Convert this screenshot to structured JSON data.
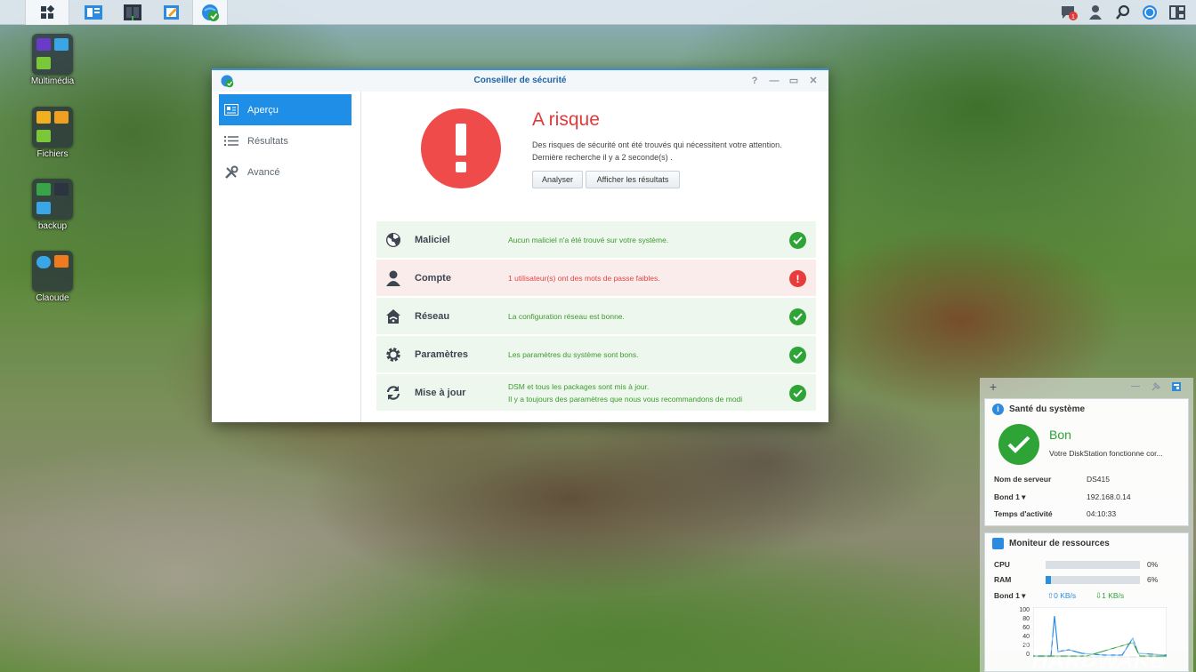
{
  "taskbar": {
    "apps": [
      "main-menu",
      "file-station",
      "storage-manager",
      "text-editor",
      "security-advisor"
    ],
    "tray": [
      "notifications",
      "user",
      "search",
      "dsm-help",
      "widgets"
    ],
    "notification_count": "1"
  },
  "desktop": {
    "icons": [
      {
        "label": "Multimédia"
      },
      {
        "label": "Fichiers"
      },
      {
        "label": "backup"
      },
      {
        "label": "Claoude"
      }
    ]
  },
  "window": {
    "title": "Conseiller de sécurité",
    "controls": {
      "help": "?",
      "minimize": "—",
      "maximize": "▭",
      "close": "✕"
    },
    "sidebar": [
      {
        "label": "Aperçu"
      },
      {
        "label": "Résultats"
      },
      {
        "label": "Avancé"
      }
    ],
    "status": {
      "title": "A risque",
      "line1": "Des risques de sécurité ont été trouvés qui nécessitent votre attention.",
      "line2": "Dernière recherche il y a 2 seconde(s) ."
    },
    "buttons": {
      "scan": "Analyser",
      "show_results": "Afficher les résultats"
    },
    "checks": [
      {
        "name": "Maliciel",
        "message": "Aucun maliciel n'a été trouvé sur votre système.",
        "status": "ok"
      },
      {
        "name": "Compte",
        "message": "1 utilisateur(s) ont des mots de passe faibles.",
        "status": "warning"
      },
      {
        "name": "Réseau",
        "message": "La configuration réseau est bonne.",
        "status": "ok"
      },
      {
        "name": "Paramètres",
        "message": "Les paramètres du système sont bons.",
        "status": "ok"
      },
      {
        "name": "Mise à jour",
        "message": "DSM et tous les packages sont mis à jour.",
        "message2": "Il y a toujours des paramètres que nous vous recommandons de modi",
        "status": "ok"
      }
    ]
  },
  "widgets": {
    "add": "+",
    "health": {
      "title": "Santé du système",
      "state": "Bon",
      "description": "Votre DiskStation fonctionne cor...",
      "rows": [
        {
          "key": "Nom de serveur",
          "value": "DS415"
        },
        {
          "key": "Bond 1 ▾",
          "value": "192.168.0.14"
        },
        {
          "key": "Temps d'activité",
          "value": "04:10:33"
        }
      ]
    },
    "monitor": {
      "title": "Moniteur de ressources",
      "cpu_label": "CPU",
      "cpu_pct": "0%",
      "cpu_value": 0,
      "ram_label": "RAM",
      "ram_pct": "6%",
      "ram_value": 6,
      "net_label": "Bond 1 ▾",
      "upload": "0 KB/s",
      "download": "1 KB/s",
      "y_ticks": [
        "100",
        "80",
        "60",
        "40",
        "20",
        "0"
      ]
    }
  },
  "watermark": {
    "line1": "COMPTOIR",
    "line2": "HARDWARE"
  }
}
